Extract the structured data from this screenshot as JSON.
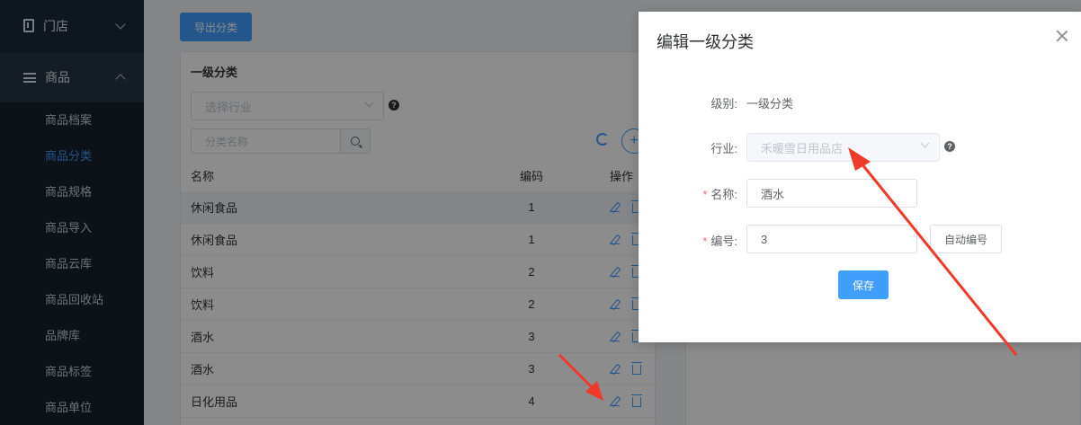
{
  "sidebar": {
    "store_label": "门店",
    "goods_label": "商品",
    "items": [
      {
        "label": "商品档案"
      },
      {
        "label": "商品分类"
      },
      {
        "label": "商品规格"
      },
      {
        "label": "商品导入"
      },
      {
        "label": "商品云库"
      },
      {
        "label": "商品回收站"
      },
      {
        "label": "品牌库"
      },
      {
        "label": "商品标签"
      },
      {
        "label": "商品单位"
      }
    ],
    "active_index": 1
  },
  "main": {
    "export_label": "导出分类",
    "panel_title": "一级分类",
    "industry_placeholder": "选择行业",
    "name_search_placeholder": "分类名称",
    "columns": {
      "name": "名称",
      "code": "编码",
      "op": "操作"
    },
    "rows": [
      {
        "name": "休闲食品",
        "code": "1"
      },
      {
        "name": "休闲食品",
        "code": "1"
      },
      {
        "name": "饮料",
        "code": "2"
      },
      {
        "name": "饮料",
        "code": "2"
      },
      {
        "name": "酒水",
        "code": "3"
      },
      {
        "name": "酒水",
        "code": "3"
      },
      {
        "name": "日化用品",
        "code": "4"
      }
    ]
  },
  "dialog": {
    "title": "编辑一级分类",
    "level_label": "级别:",
    "level_value": "一级分类",
    "industry_label": "行业:",
    "industry_value": "禾暖雪日用品店",
    "name_label": "名称:",
    "name_value": "酒水",
    "code_label": "编号:",
    "code_value": "3",
    "auto_code_label": "自动编号",
    "save_label": "保存"
  },
  "colors": {
    "primary": "#409eff",
    "sidebar_bg": "#1f2d3d",
    "arrow": "#f0392b"
  }
}
